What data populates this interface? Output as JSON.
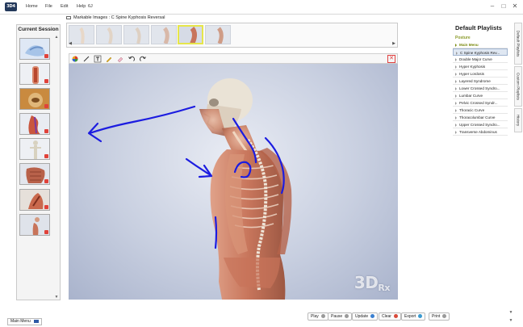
{
  "menubar": {
    "logo_text": "3D4",
    "items": [
      "Home",
      "File",
      "Edit",
      "Help"
    ],
    "extra": "6J",
    "window_controls": [
      "–",
      "□",
      "✕"
    ]
  },
  "session": {
    "title": "Current Session",
    "scroll_up": "▲",
    "scroll_down": "▼"
  },
  "breadcrumb": {
    "text": "Markable Images : C Spine Kyphosis Reversal"
  },
  "filmstrip": {
    "nav_left": "◀",
    "nav_right": "▶"
  },
  "toolbar": {
    "icons": [
      "color-wheel-icon",
      "line-icon",
      "text-icon",
      "pencil-icon",
      "eraser-icon",
      "undo-icon",
      "redo-icon"
    ],
    "close": "✕"
  },
  "canvas": {
    "watermark": "3D",
    "watermark_sub": "Rx",
    "annotation_color": "#1c1ce0"
  },
  "playlists": {
    "title": "Default Playlists",
    "category": "Posture",
    "items": [
      "Main Menu",
      "C Spine Kyphosis Rev...",
      "Double Major Curve",
      "Hyper Kyphosis",
      "Hyper Lordosis",
      "Layered Syndrome",
      "Lower Crossed Syndro...",
      "Lumbar Curve",
      "Pelvic Crossed Syndr...",
      "Thoracic Curve",
      "Thoracolumbar Curve",
      "Upper Crossed Syndro...",
      "Transverse Abdominus"
    ]
  },
  "side_tabs": [
    "Default Playlists",
    "Custom Playlists",
    "History"
  ],
  "bottom": {
    "main_menu": "Main Menu",
    "buttons": [
      "Play",
      "Pause",
      "Update",
      "Clear",
      "Export",
      "Print"
    ]
  }
}
